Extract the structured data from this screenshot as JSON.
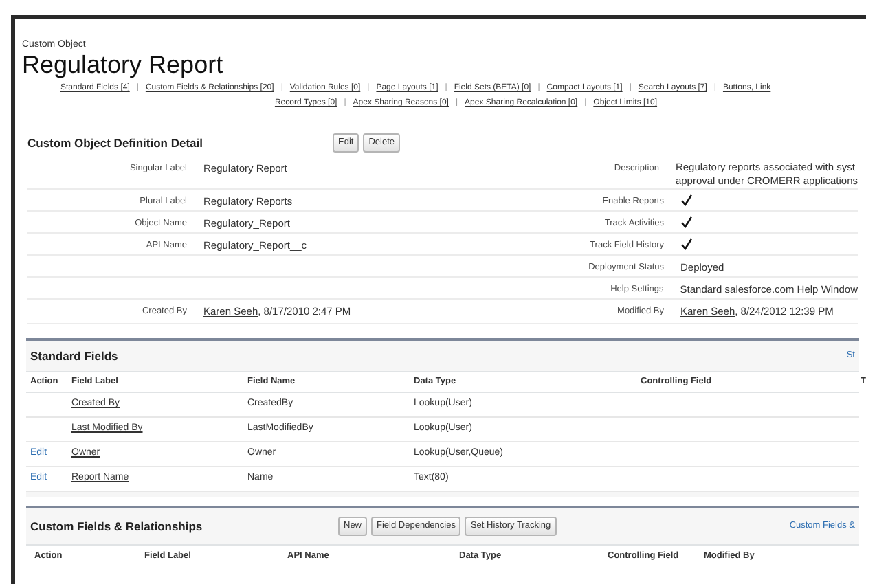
{
  "object_type": "Custom Object",
  "title": "Regulatory Report",
  "nav_separator": "|",
  "nav_rows": [
    [
      "Standard Fields [4]",
      "Custom Fields & Relationships [20]",
      "Validation Rules [0]",
      "Page Layouts [1]",
      "Field Sets (BETA) [0]",
      "Compact Layouts [1]",
      "Search Layouts [7]",
      "Buttons, Link"
    ],
    [
      "Record Types [0]",
      "Apex Sharing Reasons [0]",
      "Apex Sharing Recalculation [0]",
      "Object Limits [10]"
    ]
  ],
  "detail": {
    "title": "Custom Object Definition Detail",
    "buttons": [
      "Edit",
      "Delete"
    ],
    "rows": [
      {
        "left": {
          "label": "Singular Label",
          "kind": "text",
          "value": "Regulatory Report"
        },
        "right": {
          "label": "Description",
          "kind": "lines",
          "lines": [
            "Regulatory reports associated with syst",
            "approval under CROMERR applications"
          ]
        }
      },
      {
        "left": {
          "label": "Plural Label",
          "kind": "text",
          "value": "Regulatory Reports"
        },
        "right": {
          "label": "Enable Reports",
          "kind": "check",
          "checked": true
        }
      },
      {
        "left": {
          "label": "Object Name",
          "kind": "text",
          "value": "Regulatory_Report"
        },
        "right": {
          "label": "Track Activities",
          "kind": "check",
          "checked": true
        }
      },
      {
        "left": {
          "label": "API Name",
          "kind": "text",
          "value": "Regulatory_Report__c"
        },
        "right": {
          "label": "Track Field History",
          "kind": "check",
          "checked": true
        }
      },
      {
        "right": {
          "label": "Deployment Status",
          "kind": "text",
          "value": "Deployed"
        }
      },
      {
        "right": {
          "label": "Help Settings",
          "kind": "text",
          "value": "Standard salesforce.com Help Window"
        }
      },
      {
        "left": {
          "label": "Created By",
          "kind": "user",
          "link": "Karen Seeh",
          "value": ", 8/17/2010 2:47 PM"
        },
        "right": {
          "label": "Modified By",
          "kind": "user",
          "link": "Karen Seeh",
          "value": ", 8/24/2012 12:39 PM"
        }
      }
    ]
  },
  "standard_fields": {
    "title": "Standard Fields",
    "link": "St",
    "columns": [
      "Action",
      "Field Label",
      "Field Name",
      "Data Type",
      "Controlling Field",
      "T"
    ],
    "rows": [
      {
        "field_label": "Created By",
        "field_name": "CreatedBy",
        "data_type": "Lookup(User)"
      },
      {
        "field_label": "Last Modified By",
        "field_name": "LastModifiedBy",
        "data_type": "Lookup(User)"
      },
      {
        "action": "Edit",
        "field_label": "Owner",
        "field_name": "Owner",
        "data_type": "Lookup(User,Queue)"
      },
      {
        "action": "Edit",
        "field_label": "Report Name",
        "field_name": "Name",
        "data_type": "Text(80)"
      }
    ]
  },
  "custom_fields": {
    "title": "Custom Fields & Relationships",
    "buttons": [
      "New",
      "Field Dependencies",
      "Set History Tracking"
    ],
    "link": "Custom Fields &",
    "columns": [
      "Action",
      "Field Label",
      "API Name",
      "Data Type",
      "Controlling Field",
      "Modified By"
    ]
  }
}
